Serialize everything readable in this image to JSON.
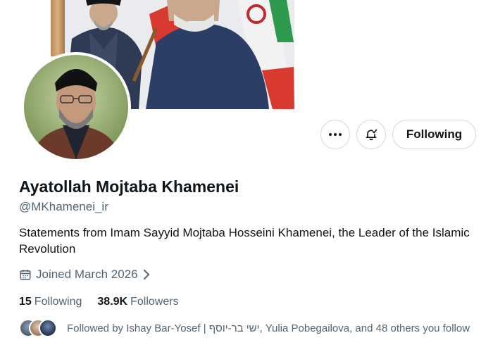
{
  "profile": {
    "name": "Ayatollah Mojtaba Khamenei",
    "handle": "@MKhamenei_ir",
    "bio": "Statements from Imam Sayyid Mojtaba Hosseini Khamenei, the Leader of the Islamic Revolution",
    "joined": "Joined March 2026"
  },
  "actions": {
    "more_icon": "more-horizontal-icon",
    "notify_icon": "bell-check-icon",
    "follow_label": "Following"
  },
  "stats": {
    "following_count": "15",
    "following_label": "Following",
    "followers_count": "38.9K",
    "followers_label": "Followers"
  },
  "followed_by": {
    "text": "Followed by Ishay Bar-Yosef | ישי בר-יוסף, Yulia Pobegailova, and 48 others you follow"
  },
  "colors": {
    "text_primary": "#0f1419",
    "text_secondary": "#536471",
    "border": "#cfd9de"
  }
}
